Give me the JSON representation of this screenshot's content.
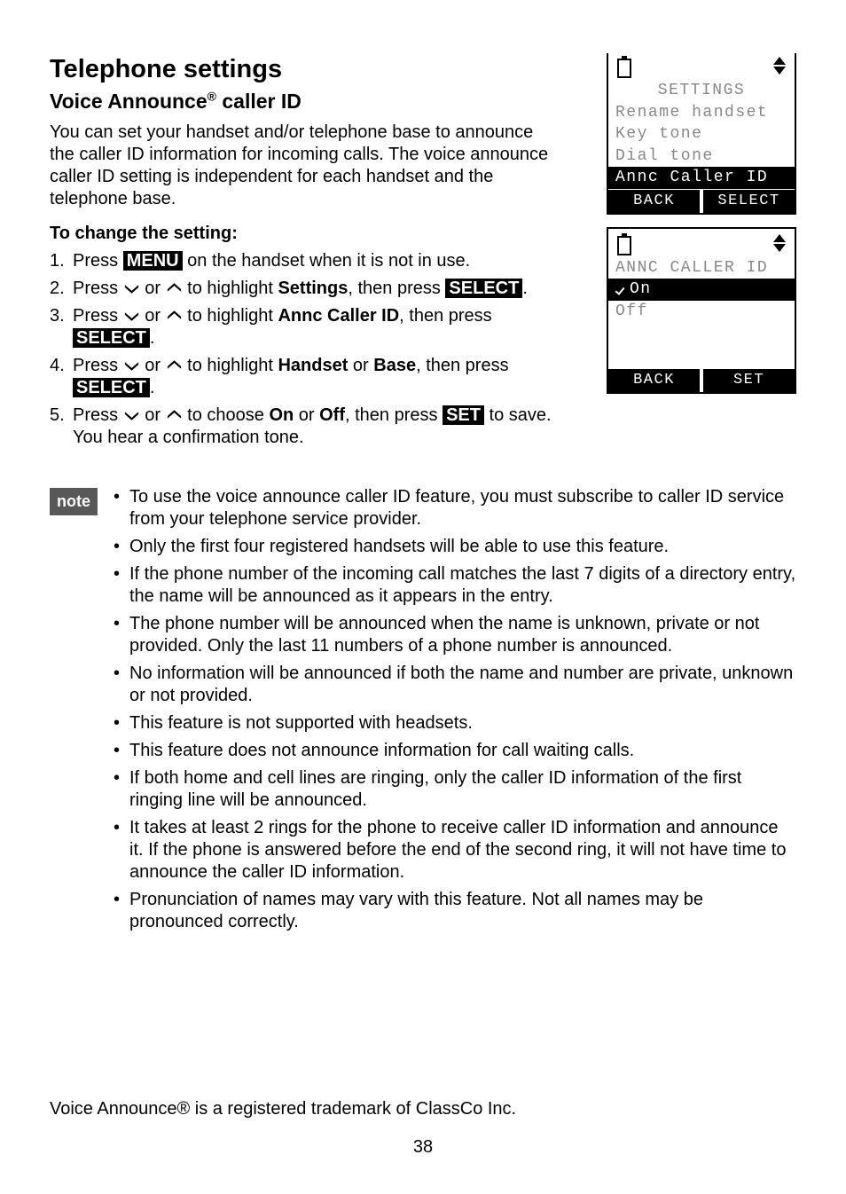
{
  "title": "Telephone settings",
  "subtitle_prefix": "Voice Announce",
  "subtitle_suffix": " caller ID",
  "intro": "You can set your handset and/or telephone base to announce the caller ID information for incoming calls. The voice announce caller ID setting is independent for each handset and the telephone base.",
  "heading_change": "To change the setting:",
  "steps": {
    "s1": {
      "num": "1.",
      "a": "Press ",
      "b": "MENU",
      "c": " on the handset when it is not in use."
    },
    "s2": {
      "num": "2.",
      "a": "Press ",
      "b": " or ",
      "c": " to highlight ",
      "d": "Settings",
      "e": ", then press ",
      "f": "SELECT",
      "g": "."
    },
    "s3": {
      "num": "3.",
      "a": "Press ",
      "b": " or ",
      "c": " to highlight ",
      "d": "Annc Caller ID",
      "e": ", then press ",
      "f": "SELECT",
      "g": "."
    },
    "s4": {
      "num": "4.",
      "a": "Press ",
      "b": " or ",
      "c": " to highlight ",
      "d": "Handset",
      "e": " or ",
      "f": "Base",
      "g": ", then press ",
      "h": "SELECT",
      "i": "."
    },
    "s5": {
      "num": "5.",
      "a": "Press ",
      "b": " or ",
      "c": " to choose ",
      "d": "On",
      "e": " or ",
      "f": "Off",
      "g": ", then press ",
      "h": "SET",
      "i": " to save. You hear a confirmation tone."
    }
  },
  "note_label": "note",
  "notes": [
    "To use the voice announce caller ID feature, you must subscribe to caller ID service from your telephone service provider.",
    "Only the first four registered handsets will be able to use this feature.",
    "If the phone number of the incoming call matches the last 7 digits of a directory entry, the name will be announced as it appears in the entry.",
    "The phone number will be announced when the name is unknown, private or not provided. Only the last 11 numbers of a phone number is announced.",
    "No information will be announced if both the name and number are private, unknown or not provided.",
    "This feature is not supported with headsets.",
    "This feature does not announce information for call waiting calls.",
    "If both home and cell lines are ringing, only the caller ID information of the first ringing line will be announced.",
    "It takes at least 2 rings for the phone to receive caller ID information and announce it. If the phone is answered before the end of the second ring, it will not have time to announce the caller ID information.",
    "Pronunciation of names may vary with this feature. Not all names may be pronounced correctly."
  ],
  "trademark": "Voice Announce® is a registered trademark of ClassCo Inc.",
  "page_num": "38",
  "lcd1": {
    "title": "SETTINGS",
    "l1": "Rename handset",
    "l2": "Key tone",
    "l3": "Dial tone",
    "l4": "Annc Caller ID",
    "left": "BACK",
    "right": "SELECT"
  },
  "lcd2": {
    "title": "ANNC CALLER ID",
    "l1": "On",
    "l2": " Off",
    "left": "BACK",
    "right": "SET"
  }
}
